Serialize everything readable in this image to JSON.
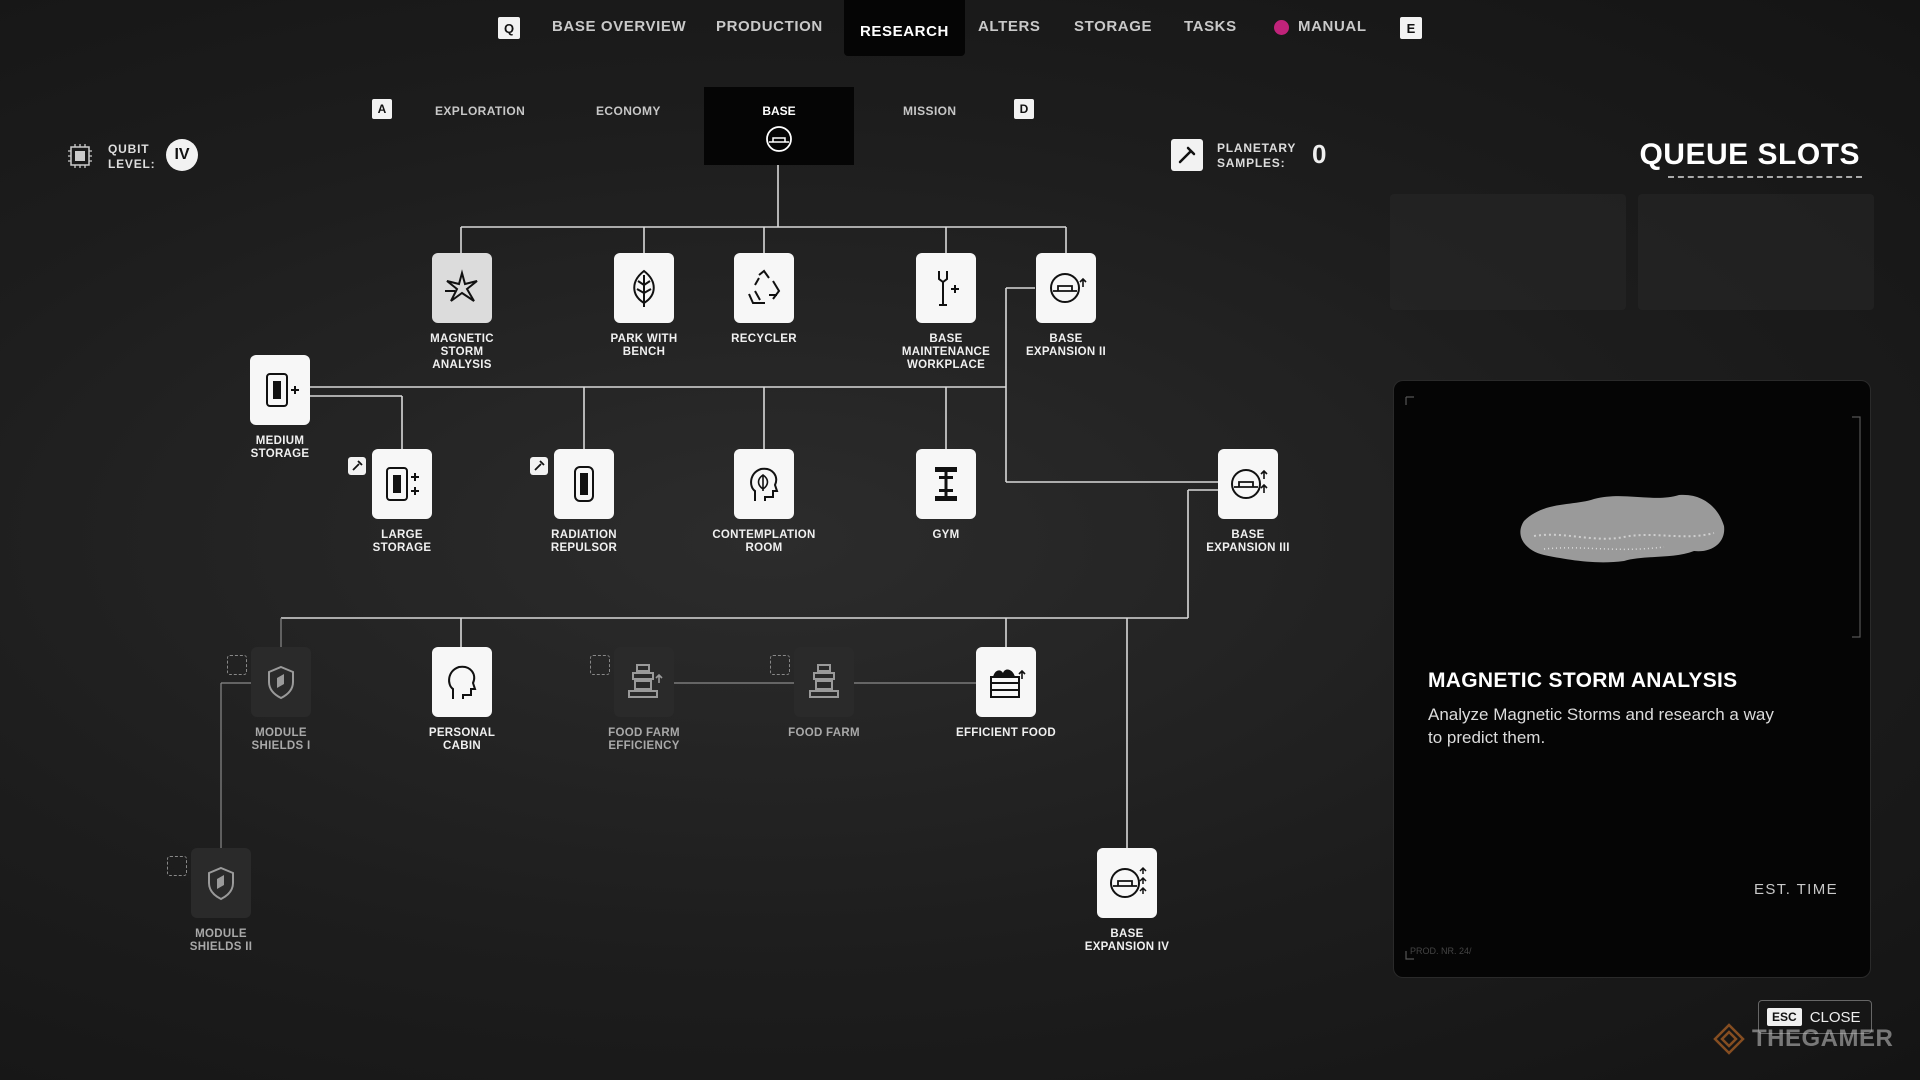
{
  "top_nav": {
    "left_key": "Q",
    "right_key": "E",
    "items": [
      "BASE OVERVIEW",
      "PRODUCTION",
      "RESEARCH",
      "ALTERS",
      "STORAGE",
      "TASKS",
      "MANUAL"
    ],
    "active": "RESEARCH"
  },
  "sub_nav": {
    "left_key": "A",
    "right_key": "D",
    "items": [
      "EXPLORATION",
      "ECONOMY",
      "BASE",
      "MISSION"
    ],
    "active": "BASE"
  },
  "qubit": {
    "label_line1": "QUBIT",
    "label_line2": "LEVEL:",
    "value": "IV"
  },
  "samples": {
    "label_line1": "PLANETARY",
    "label_line2": "SAMPLES:",
    "value": "0"
  },
  "queue": {
    "title": "QUEUE SLOTS"
  },
  "tree": {
    "nodes": {
      "magnetic_storm": "MAGNETIC\nSTORM\nANALYSIS",
      "park": "PARK WITH\nBENCH",
      "recycler": "RECYCLER",
      "maintenance": "BASE\nMAINTENANCE\nWORKPLACE",
      "expansion2": "BASE\nEXPANSION II",
      "medium_storage": "MEDIUM\nSTORAGE",
      "large_storage": "LARGE\nSTORAGE",
      "radiation": "RADIATION\nREPULSOR",
      "contemplation": "CONTEMPLATION\nROOM",
      "gym": "GYM",
      "expansion3": "BASE\nEXPANSION III",
      "shields1": "MODULE\nSHIELDS I",
      "cabin": "PERSONAL\nCABIN",
      "farm_eff": "FOOD FARM\nEFFICIENCY",
      "farm": "FOOD FARM",
      "eff_food": "EFFICIENT FOOD",
      "shields2": "MODULE\nSHIELDS II",
      "expansion4": "BASE\nEXPANSION IV"
    }
  },
  "detail": {
    "title": "MAGNETIC STORM ANALYSIS",
    "description": "Analyze Magnetic Storms and research a way to predict them.",
    "est_time_label": "EST. TIME",
    "footer_code": "PROD. NR. 24/"
  },
  "close": {
    "key": "ESC",
    "label": "CLOSE"
  },
  "watermark": "THEGAMER"
}
